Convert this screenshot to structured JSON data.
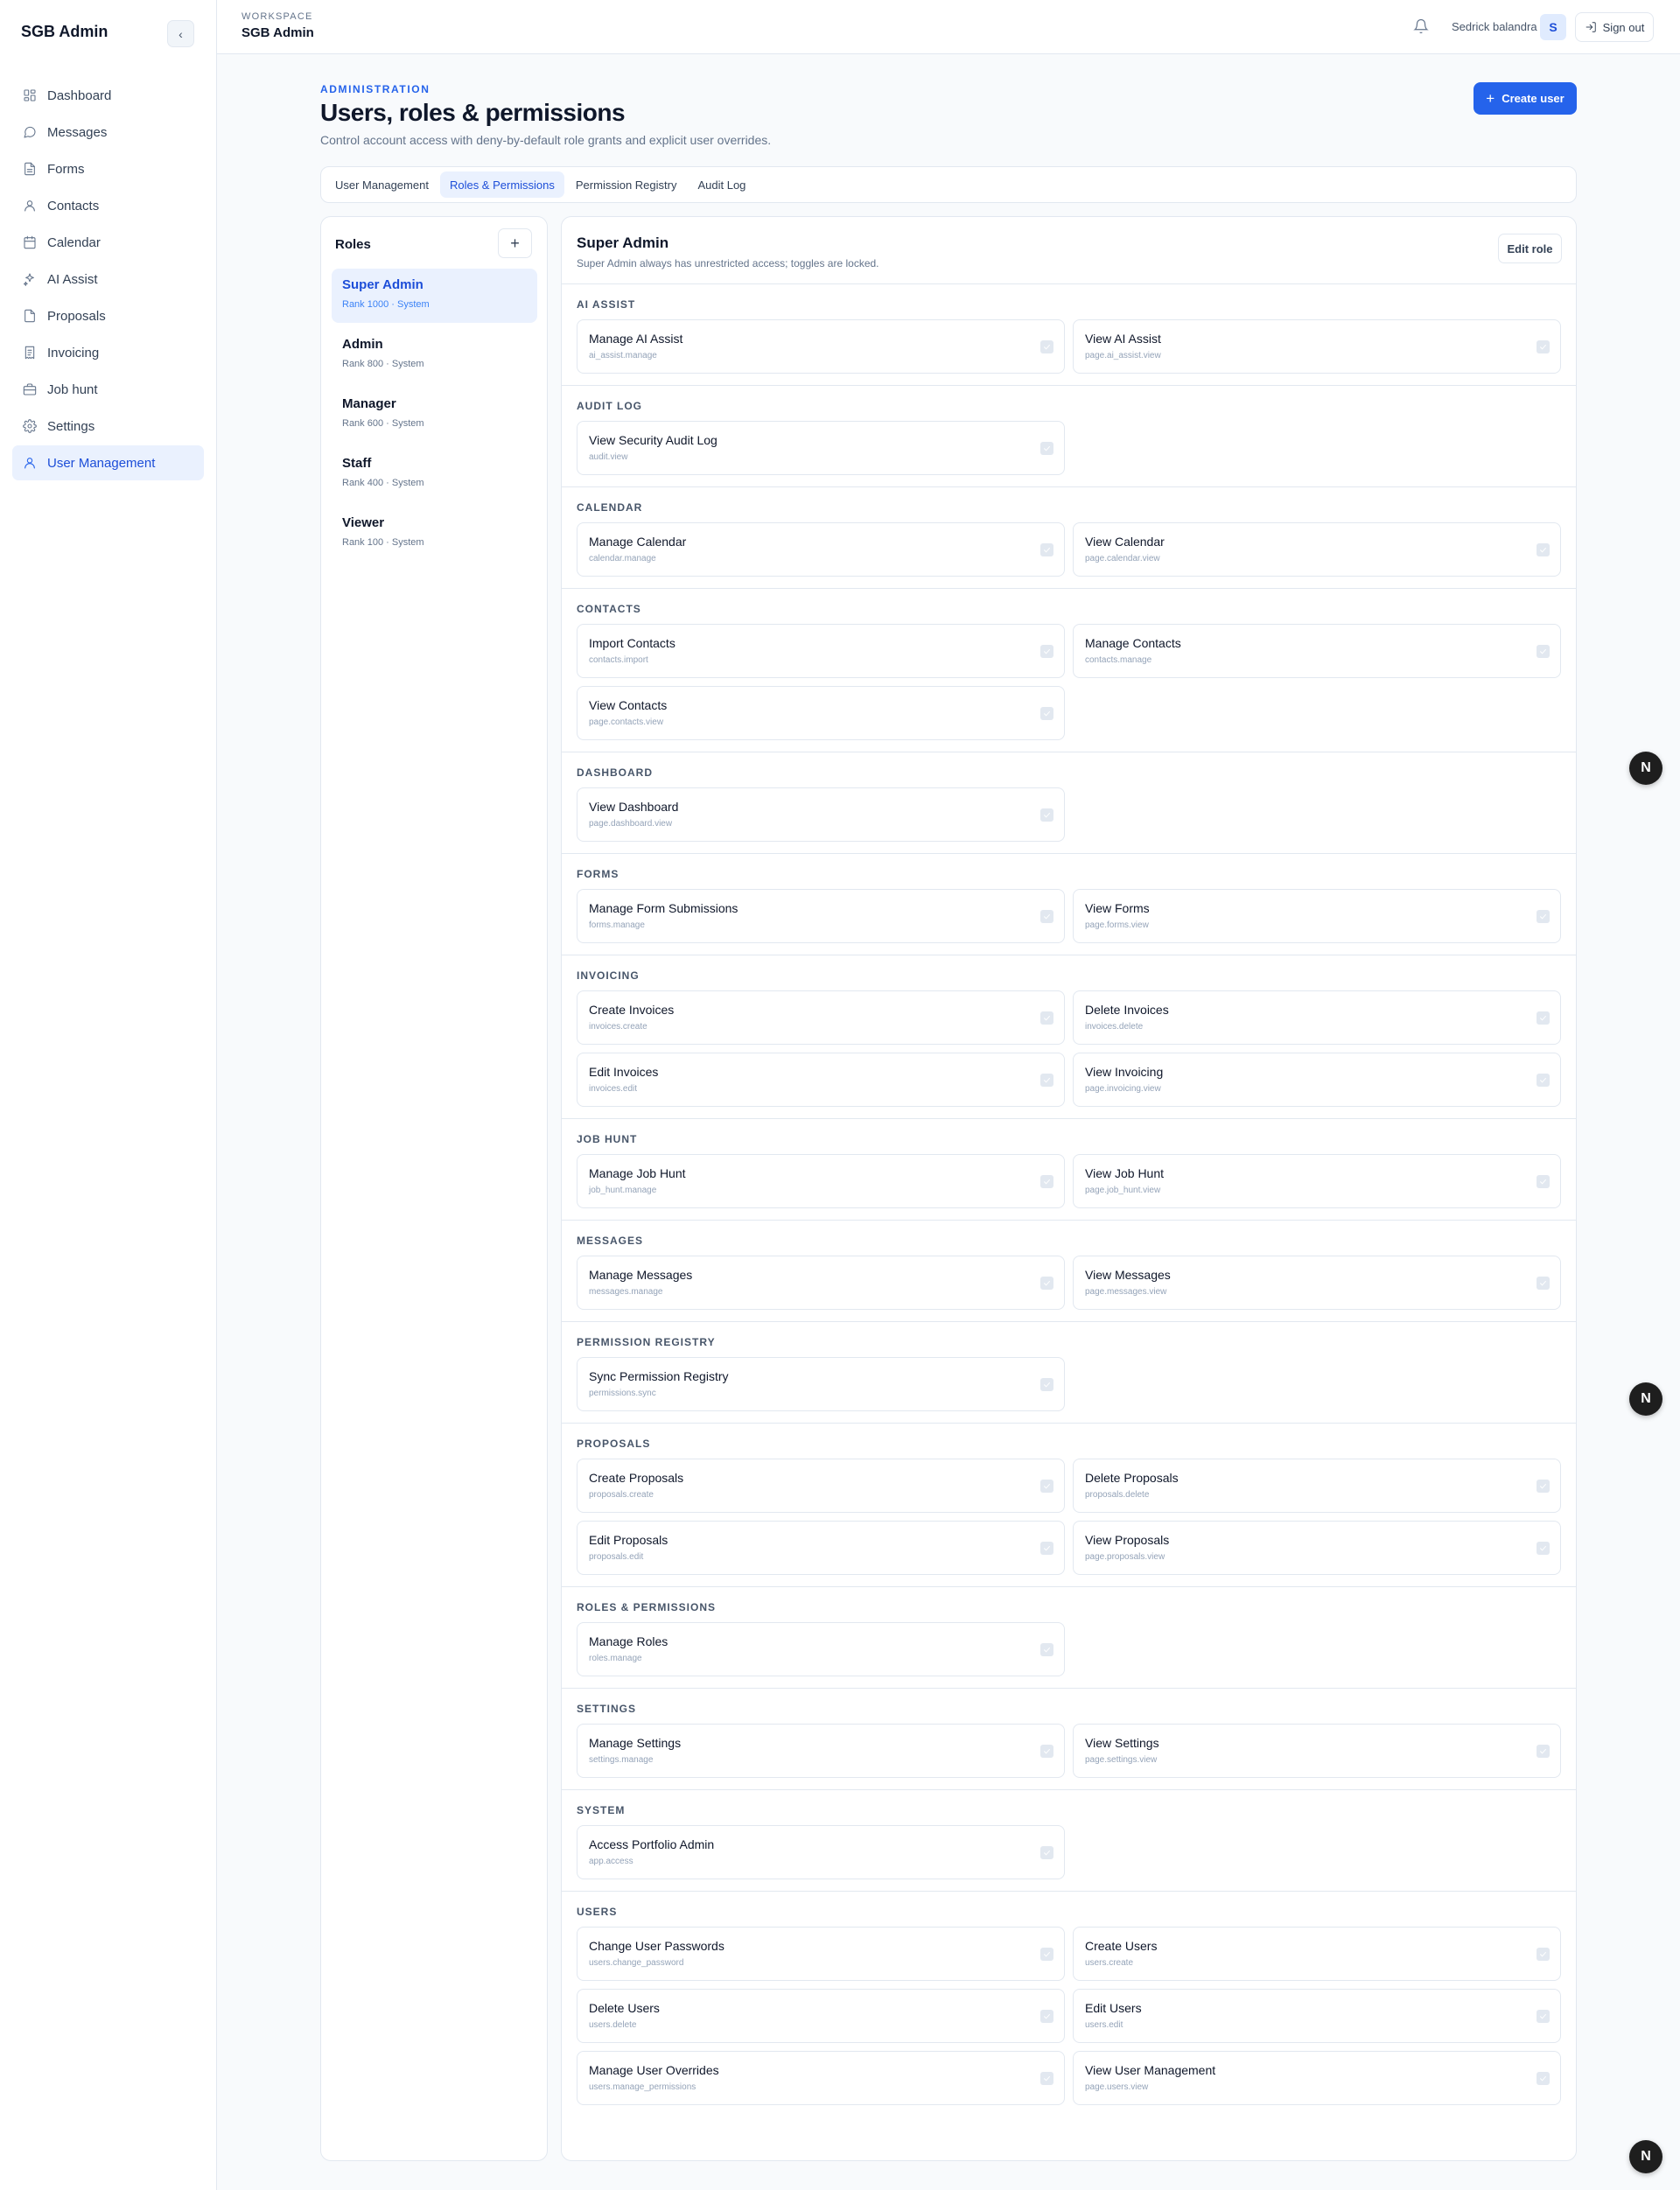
{
  "sidebar": {
    "brand": "SGB Admin",
    "collapse_glyph": "‹",
    "items": [
      {
        "label": "Dashboard",
        "icon": "dashboard-icon"
      },
      {
        "label": "Messages",
        "icon": "message-icon"
      },
      {
        "label": "Forms",
        "icon": "forms-icon"
      },
      {
        "label": "Contacts",
        "icon": "contacts-icon"
      },
      {
        "label": "Calendar",
        "icon": "calendar-icon"
      },
      {
        "label": "AI Assist",
        "icon": "sparkle-icon"
      },
      {
        "label": "Proposals",
        "icon": "proposals-icon"
      },
      {
        "label": "Invoicing",
        "icon": "invoice-icon"
      },
      {
        "label": "Job hunt",
        "icon": "briefcase-icon"
      },
      {
        "label": "Settings",
        "icon": "gear-icon"
      },
      {
        "label": "User Management",
        "icon": "user-icon",
        "active": true
      }
    ]
  },
  "topbar": {
    "workspace_label": "WORKSPACE",
    "workspace_name": "SGB Admin",
    "user_name": "Sedrick balandra",
    "avatar_initial": "S",
    "sign_out": "Sign out"
  },
  "header": {
    "eyebrow": "ADMINISTRATION",
    "title": "Users, roles & permissions",
    "subtitle": "Control account access with deny-by-default role grants and explicit user overrides.",
    "create_button": "Create user"
  },
  "tabs": [
    {
      "label": "User Management",
      "active": false
    },
    {
      "label": "Roles & Permissions",
      "active": true
    },
    {
      "label": "Permission Registry",
      "active": false
    },
    {
      "label": "Audit Log",
      "active": false
    }
  ],
  "roles": {
    "title": "Roles",
    "add_glyph": "+",
    "items": [
      {
        "name": "Super Admin",
        "meta": "Rank 1000 · System",
        "active": true
      },
      {
        "name": "Admin",
        "meta": "Rank 800 · System",
        "active": false
      },
      {
        "name": "Manager",
        "meta": "Rank 600 · System",
        "active": false
      },
      {
        "name": "Staff",
        "meta": "Rank 400 · System",
        "active": false
      },
      {
        "name": "Viewer",
        "meta": "Rank 100 · System",
        "active": false
      }
    ]
  },
  "permissions": {
    "role_title": "Super Admin",
    "role_note": "Super Admin always has unrestricted access; toggles are locked.",
    "edit_button": "Edit role",
    "sections": [
      {
        "title": "AI ASSIST",
        "items": [
          {
            "name": "Manage AI Assist",
            "key": "ai_assist.manage",
            "checked": true
          },
          {
            "name": "View AI Assist",
            "key": "page.ai_assist.view",
            "checked": true
          }
        ]
      },
      {
        "title": "AUDIT LOG",
        "items": [
          {
            "name": "View Security Audit Log",
            "key": "audit.view",
            "checked": true
          }
        ]
      },
      {
        "title": "CALENDAR",
        "items": [
          {
            "name": "Manage Calendar",
            "key": "calendar.manage",
            "checked": true
          },
          {
            "name": "View Calendar",
            "key": "page.calendar.view",
            "checked": true
          }
        ]
      },
      {
        "title": "CONTACTS",
        "items": [
          {
            "name": "Import Contacts",
            "key": "contacts.import",
            "checked": true
          },
          {
            "name": "Manage Contacts",
            "key": "contacts.manage",
            "checked": true
          },
          {
            "name": "View Contacts",
            "key": "page.contacts.view",
            "checked": true
          }
        ]
      },
      {
        "title": "DASHBOARD",
        "items": [
          {
            "name": "View Dashboard",
            "key": "page.dashboard.view",
            "checked": true
          }
        ]
      },
      {
        "title": "FORMS",
        "items": [
          {
            "name": "Manage Form Submissions",
            "key": "forms.manage",
            "checked": true
          },
          {
            "name": "View Forms",
            "key": "page.forms.view",
            "checked": true
          }
        ]
      },
      {
        "title": "INVOICING",
        "items": [
          {
            "name": "Create Invoices",
            "key": "invoices.create",
            "checked": true
          },
          {
            "name": "Delete Invoices",
            "key": "invoices.delete",
            "checked": true
          },
          {
            "name": "Edit Invoices",
            "key": "invoices.edit",
            "checked": true
          },
          {
            "name": "View Invoicing",
            "key": "page.invoicing.view",
            "checked": true
          }
        ]
      },
      {
        "title": "JOB HUNT",
        "items": [
          {
            "name": "Manage Job Hunt",
            "key": "job_hunt.manage",
            "checked": true
          },
          {
            "name": "View Job Hunt",
            "key": "page.job_hunt.view",
            "checked": true
          }
        ]
      },
      {
        "title": "MESSAGES",
        "items": [
          {
            "name": "Manage Messages",
            "key": "messages.manage",
            "checked": true
          },
          {
            "name": "View Messages",
            "key": "page.messages.view",
            "checked": true
          }
        ]
      },
      {
        "title": "PERMISSION REGISTRY",
        "items": [
          {
            "name": "Sync Permission Registry",
            "key": "permissions.sync",
            "checked": true
          }
        ]
      },
      {
        "title": "PROPOSALS",
        "items": [
          {
            "name": "Create Proposals",
            "key": "proposals.create",
            "checked": true
          },
          {
            "name": "Delete Proposals",
            "key": "proposals.delete",
            "checked": true
          },
          {
            "name": "Edit Proposals",
            "key": "proposals.edit",
            "checked": true
          },
          {
            "name": "View Proposals",
            "key": "page.proposals.view",
            "checked": true
          }
        ]
      },
      {
        "title": "ROLES & PERMISSIONS",
        "items": [
          {
            "name": "Manage Roles",
            "key": "roles.manage",
            "checked": true
          }
        ]
      },
      {
        "title": "SETTINGS",
        "items": [
          {
            "name": "Manage Settings",
            "key": "settings.manage",
            "checked": true
          },
          {
            "name": "View Settings",
            "key": "page.settings.view",
            "checked": true
          }
        ]
      },
      {
        "title": "SYSTEM",
        "items": [
          {
            "name": "Access Portfolio Admin",
            "key": "app.access",
            "checked": true
          }
        ]
      },
      {
        "title": "USERS",
        "items": [
          {
            "name": "Change User Passwords",
            "key": "users.change_password",
            "checked": true
          },
          {
            "name": "Create Users",
            "key": "users.create",
            "checked": true
          },
          {
            "name": "Delete Users",
            "key": "users.delete",
            "checked": true
          },
          {
            "name": "Edit Users",
            "key": "users.edit",
            "checked": true
          },
          {
            "name": "Manage User Overrides",
            "key": "users.manage_permissions",
            "checked": true
          },
          {
            "name": "View User Management",
            "key": "page.users.view",
            "checked": true
          }
        ]
      }
    ]
  },
  "floating_buttons": [
    "N",
    "N",
    "N"
  ],
  "colors": {
    "accent": "#2563eb",
    "active_bg": "#eaf1fe",
    "border": "#e2e8f0"
  }
}
